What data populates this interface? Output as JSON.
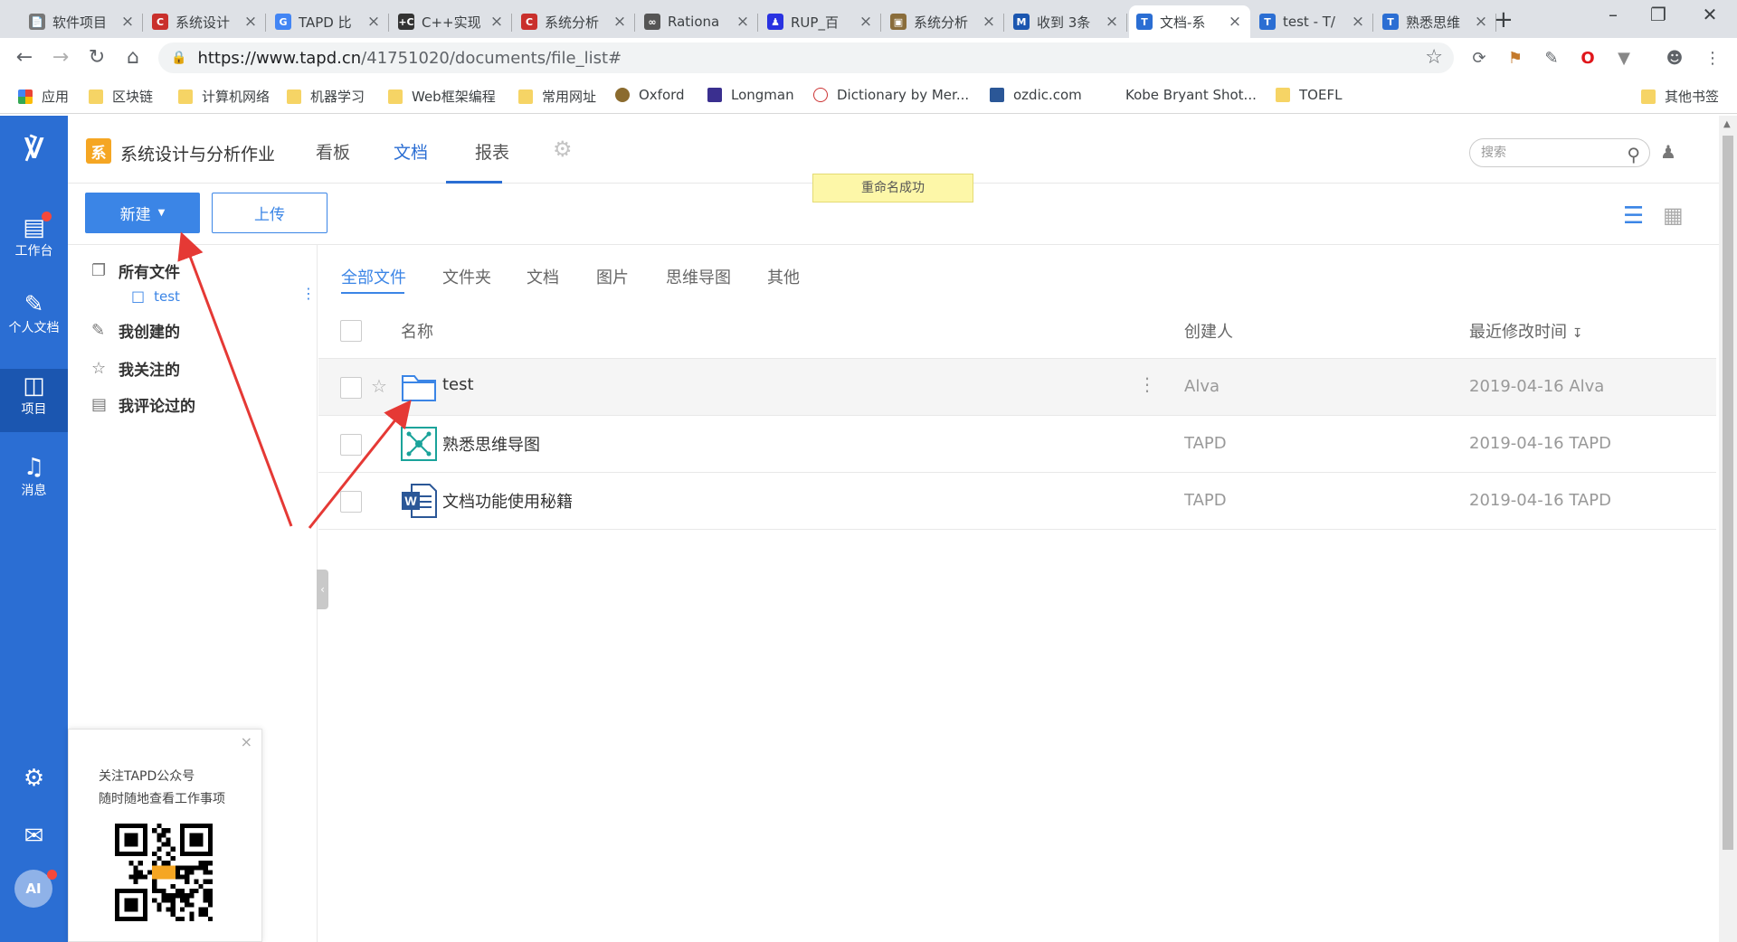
{
  "browser": {
    "tabs": [
      {
        "label": "软件项目",
        "favicon": "doc-icon",
        "color": "#777777"
      },
      {
        "label": "系统设计",
        "favicon": "csdn-icon",
        "color": "#c9302c"
      },
      {
        "label": "TAPD 比",
        "favicon": "google-icon",
        "color": "#4285f4"
      },
      {
        "label": "C++实现",
        "favicon": "cpp-icon",
        "color": "#333333"
      },
      {
        "label": "系统分析",
        "favicon": "csdn-icon",
        "color": "#c9302c"
      },
      {
        "label": "Rationa",
        "favicon": "link-icon",
        "color": "#555555"
      },
      {
        "label": "RUP_百",
        "favicon": "baidu-icon",
        "color": "#2932e1"
      },
      {
        "label": "系统分析",
        "favicon": "photo-icon",
        "color": "#8a6d3b"
      },
      {
        "label": "收到 3条",
        "favicon": "mail-icon",
        "color": "#1b56b0"
      },
      {
        "label": "文档-系",
        "favicon": "tapd-icon",
        "color": "#2b6ed3"
      },
      {
        "label": "test - T/",
        "favicon": "tapd-icon",
        "color": "#2b6ed3"
      },
      {
        "label": "熟悉思维",
        "favicon": "tapd-icon",
        "color": "#2b6ed3"
      }
    ],
    "active_tab_index": 9,
    "url_host": "https://www.tapd.cn",
    "url_path": "/41751020/documents/file_list#",
    "bookmarks": [
      {
        "label": "应用",
        "icon": "apps-icon"
      },
      {
        "label": "区块链",
        "icon": "folder-icon"
      },
      {
        "label": "计算机网络",
        "icon": "folder-icon"
      },
      {
        "label": "机器学习",
        "icon": "folder-icon"
      },
      {
        "label": "Web框架编程",
        "icon": "folder-icon"
      },
      {
        "label": "常用网址",
        "icon": "folder-icon"
      },
      {
        "label": "Oxford",
        "icon": "oxford-icon"
      },
      {
        "label": "Longman",
        "icon": "longman-icon"
      },
      {
        "label": "Dictionary by Mer...",
        "icon": "mw-icon"
      },
      {
        "label": "ozdic.com",
        "icon": "oz-icon"
      },
      {
        "label": "Kobe Bryant Shot...",
        "icon": "k-icon"
      },
      {
        "label": "TOEFL",
        "icon": "folder-icon"
      }
    ],
    "other_bookmarks": "其他书签"
  },
  "leftnav": {
    "items": [
      {
        "label": "工作台",
        "icon": "workbench-icon"
      },
      {
        "label": "个人文档",
        "icon": "personal-doc-icon"
      },
      {
        "label": "项目",
        "icon": "project-icon"
      },
      {
        "label": "消息",
        "icon": "bell-icon"
      }
    ],
    "avatar_text": "AI",
    "brand_color": "#2b6ed3"
  },
  "project": {
    "badge": "系",
    "name": "系统设计与分析作业",
    "tabs": [
      "看板",
      "文档",
      "报表"
    ],
    "active_tab": 1
  },
  "search": {
    "placeholder": "搜索"
  },
  "toast": "重命名成功",
  "actions": {
    "new_label": "新建",
    "upload_label": "上传"
  },
  "sidebar": {
    "all_files": "所有文件",
    "folder": "test",
    "created": "我创建的",
    "followed": "我关注的",
    "commented": "我评论过的"
  },
  "filters": [
    "全部文件",
    "文件夹",
    "文档",
    "图片",
    "思维导图",
    "其他"
  ],
  "table": {
    "headers": {
      "name": "名称",
      "creator": "创建人",
      "modified": "最近修改时间"
    },
    "rows": [
      {
        "name": "test",
        "type": "folder",
        "creator": "Alva",
        "modified": "2019-04-16  Alva"
      },
      {
        "name": "熟悉思维导图",
        "type": "mindmap",
        "creator": "TAPD",
        "modified": "2019-04-16  TAPD"
      },
      {
        "name": "文档功能使用秘籍",
        "type": "word",
        "creator": "TAPD",
        "modified": "2019-04-16  TAPD"
      }
    ]
  },
  "qr_popup": {
    "line1": "关注TAPD公众号",
    "line2": "随时随地查看工作事项",
    "close": "×"
  }
}
